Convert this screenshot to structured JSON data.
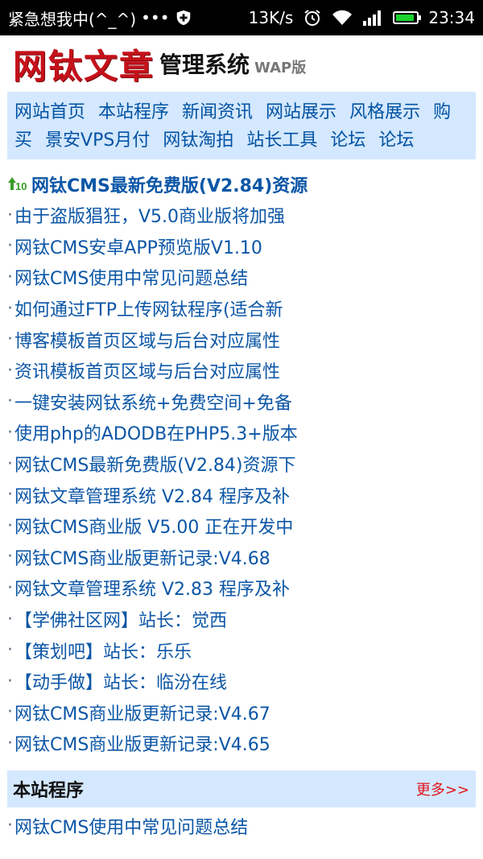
{
  "status_bar": {
    "left_text": "紧急想我中(^_^)",
    "dots": "•••",
    "net_speed": "13K/s",
    "time": "23:34"
  },
  "header": {
    "logo_main": "网钛文章",
    "logo_sub": "管理系统",
    "logo_wap": "WAP版"
  },
  "nav": {
    "items": [
      "网站首页",
      "本站程序",
      "新闻资讯",
      "网站展示",
      "风格展示",
      "购买",
      "景安VPS月付",
      "网钛淘拍",
      "站长工具",
      "论坛",
      "论坛"
    ]
  },
  "news": {
    "top": "网钛CMS最新免费版(V2.84)资源",
    "items": [
      "由于盗版猖狂，V5.0商业版将加强",
      "网钛CMS安卓APP预览版V1.10",
      "网钛CMS使用中常见问题总结",
      "如何通过FTP上传网钛程序(适合新",
      "博客模板首页区域与后台对应属性",
      "资讯模板首页区域与后台对应属性",
      "一键安装网钛系统+免费空间+免备",
      "使用php的ADODB在PHP5.3+版本",
      "网钛CMS最新免费版(V2.84)资源下",
      "网钛文章管理系统 V2.84 程序及补",
      "网钛CMS商业版 V5.00 正在开发中",
      "网钛CMS商业版更新记录:V4.68",
      "网钛文章管理系统 V2.83 程序及补",
      "【学佛社区网】站长：觉西",
      "【策划吧】站长：乐乐",
      "【动手做】站长：临汾在线",
      "网钛CMS商业版更新记录:V4.67",
      "网钛CMS商业版更新记录:V4.65"
    ]
  },
  "section": {
    "title": "本站程序",
    "more": "更多>>",
    "items": [
      "网钛CMS使用中常见问题总结"
    ]
  },
  "colors": {
    "link": "#0b56a6",
    "nav_bg": "#d4e8ff",
    "logo_red": "#c5111a",
    "more_red": "#e2141a",
    "battery_green": "#19d22e"
  }
}
